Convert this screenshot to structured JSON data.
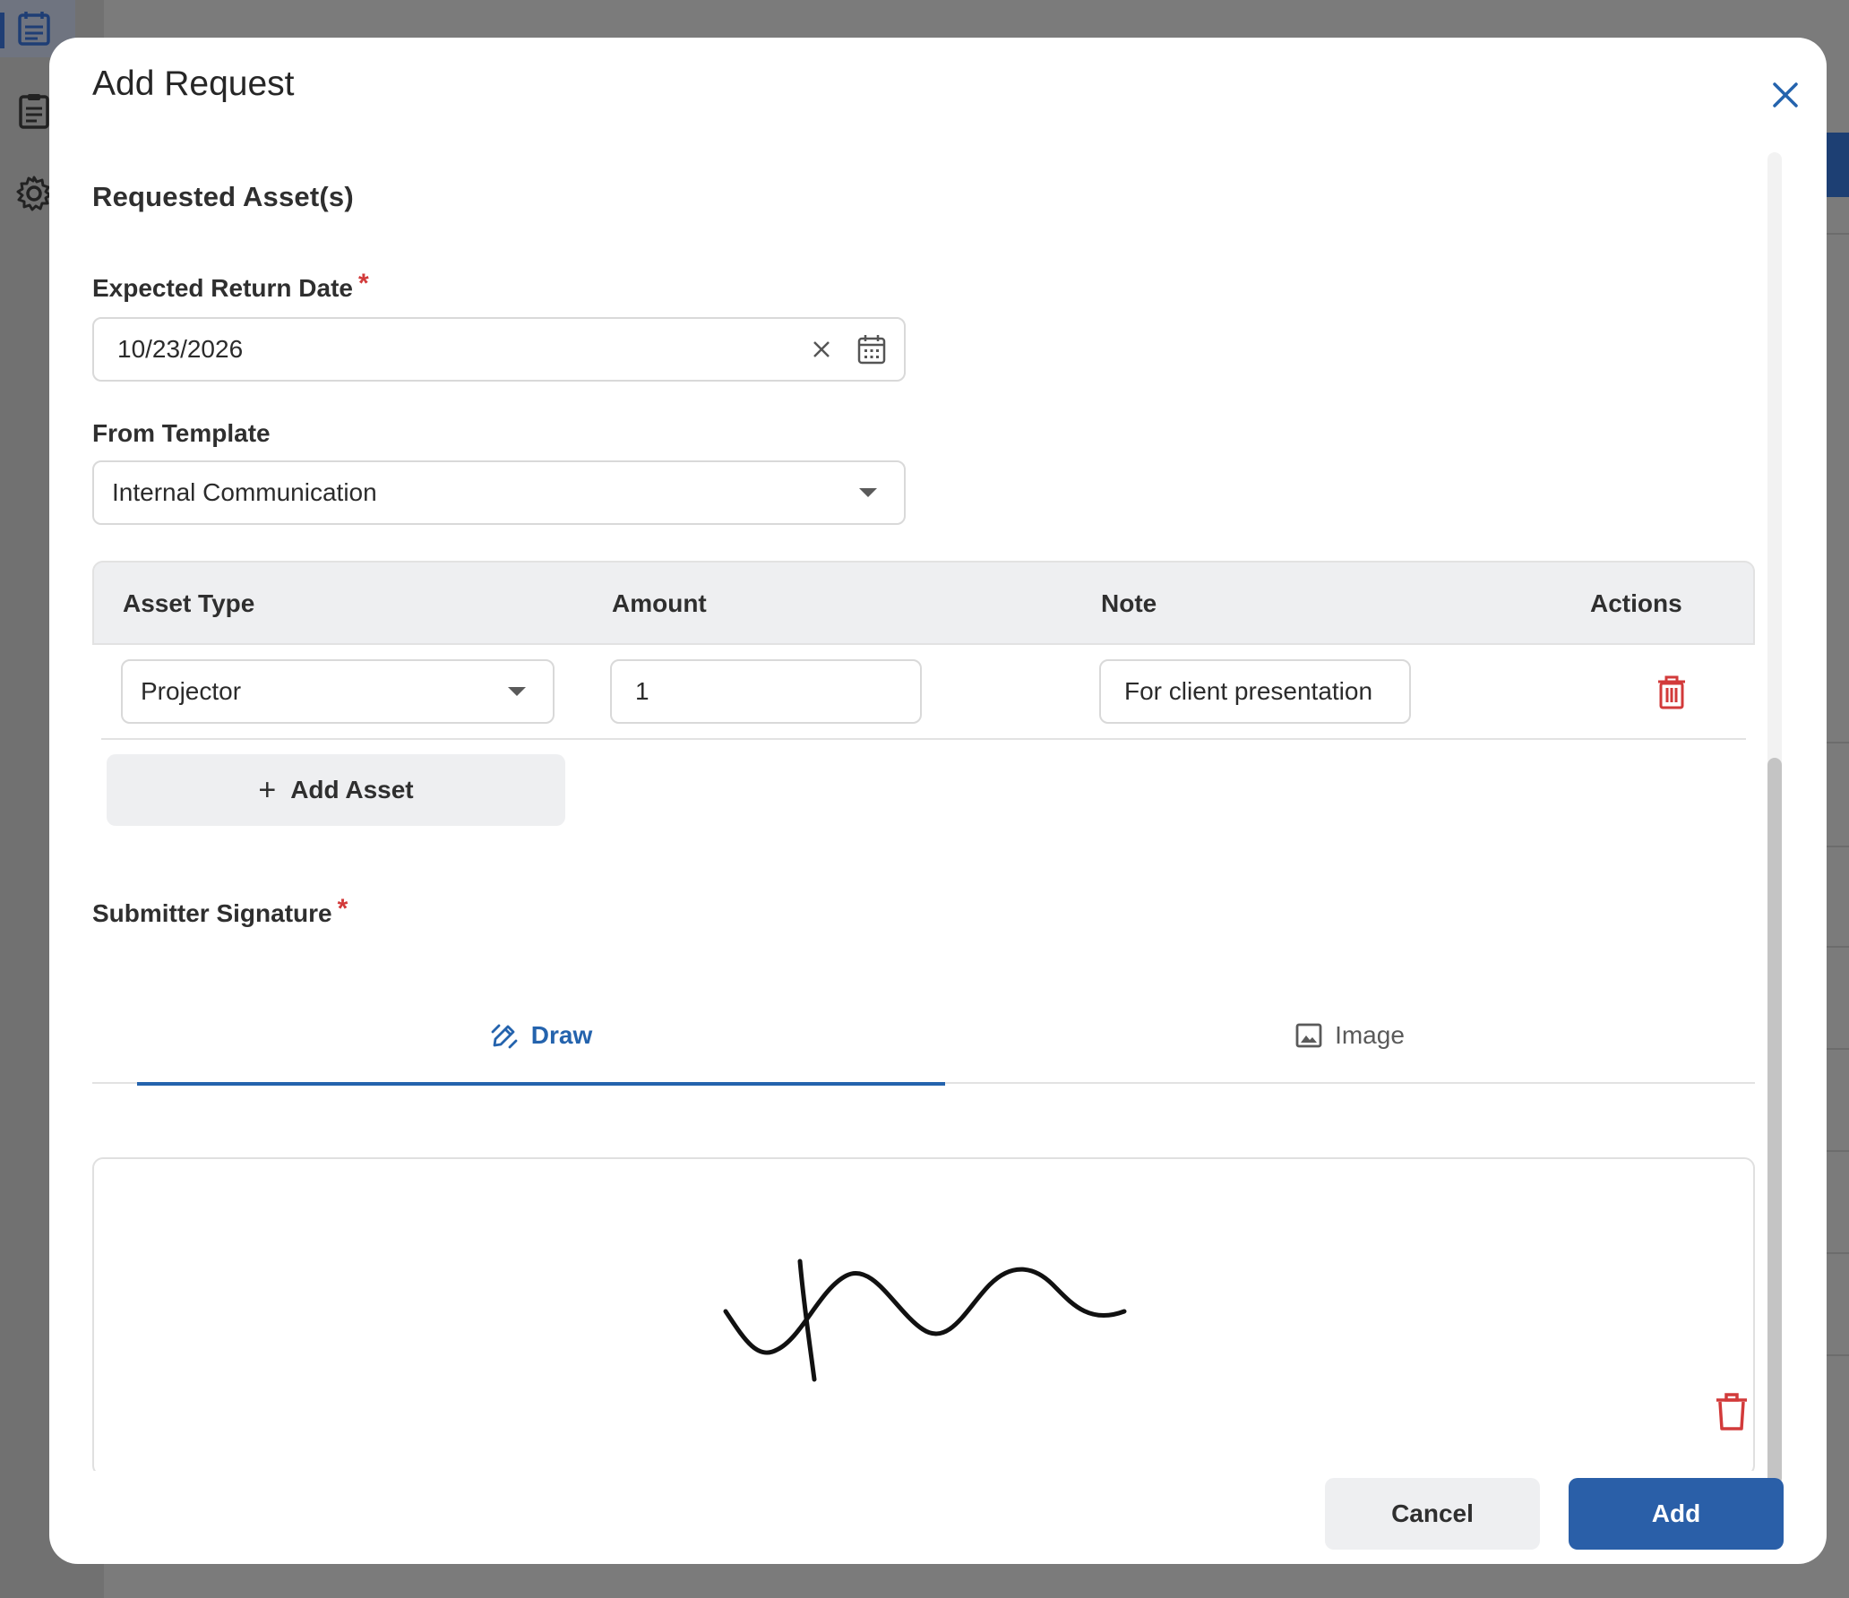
{
  "modal": {
    "title": "Add Request",
    "section_title": "Requested Asset(s)"
  },
  "return_date": {
    "label": "Expected Return Date",
    "required_mark": "*",
    "value": "10/23/2026"
  },
  "template": {
    "label": "From Template",
    "value": "Internal Communication"
  },
  "assets_table": {
    "headers": [
      "Asset Type",
      "Amount",
      "Note",
      "Actions"
    ],
    "rows": [
      {
        "asset_type": "Projector",
        "amount": "1",
        "note": "For client presentation"
      }
    ],
    "add_label": "Add Asset"
  },
  "signature": {
    "label": "Submitter Signature",
    "required_mark": "*",
    "tabs": [
      {
        "label": "Draw",
        "icon": "draw-pencil-icon",
        "active": true
      },
      {
        "label": "Image",
        "icon": "image-icon",
        "active": false
      }
    ]
  },
  "footer": {
    "cancel_label": "Cancel",
    "add_label": "Add"
  },
  "colors": {
    "accent": "#2a5fa8",
    "danger": "#d23a3a",
    "background_overlay": "#7b7b7b"
  }
}
